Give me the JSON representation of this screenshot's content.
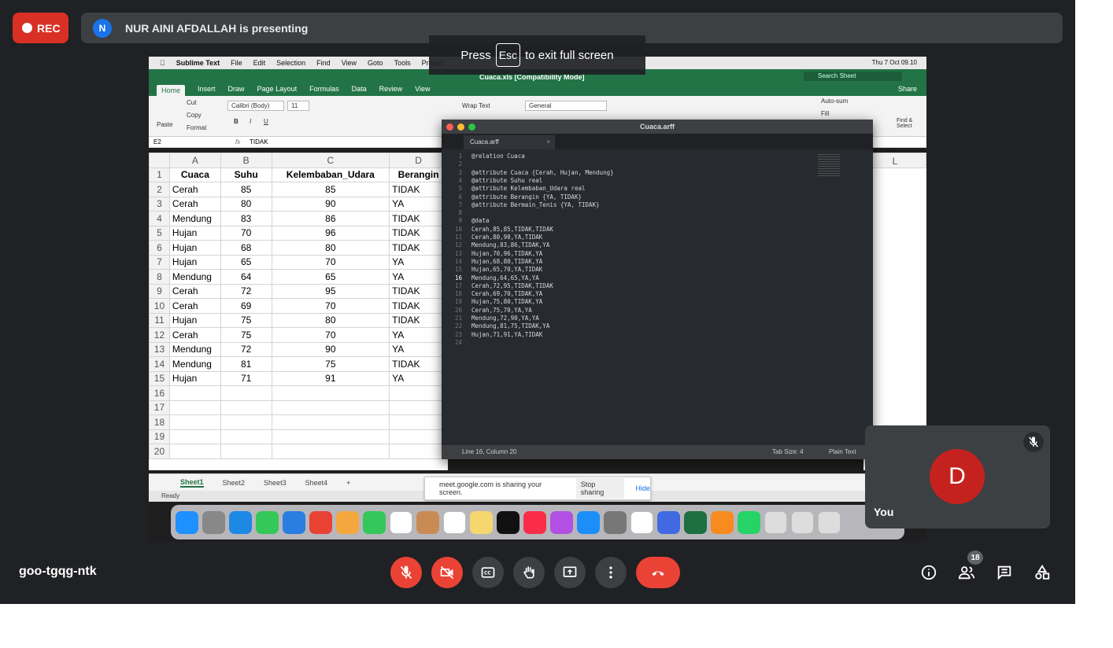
{
  "recording": {
    "label": "REC"
  },
  "presenter": {
    "initial": "N",
    "text": "NUR AINI AFDALLAH is presenting"
  },
  "fullscreen_tip": {
    "press": "Press",
    "key": "Esc",
    "rest": "to exit full screen"
  },
  "mac_menu": {
    "app": "Sublime Text",
    "items": [
      "File",
      "Edit",
      "Selection",
      "Find",
      "View",
      "Goto",
      "Tools",
      "Project"
    ],
    "clock": "Thu 7 Oct  09.10"
  },
  "excel": {
    "title": "Cuaca.xls  [Compatibility Mode]",
    "search_placeholder": "Search Sheet",
    "share": "Share",
    "tabs": [
      "Home",
      "Insert",
      "Draw",
      "Page Layout",
      "Formulas",
      "Data",
      "Review",
      "View"
    ],
    "ribbon": {
      "paste": "Paste",
      "cut": "Cut",
      "copy": "Copy",
      "format": "Format",
      "font": "Calibri (Body)",
      "size": "11",
      "wrap": "Wrap Text",
      "number_format": "General",
      "autosum": "Auto-sum",
      "fill": "Fill",
      "find": "Find &\nSelect"
    },
    "cell_ref": "E2",
    "formula": "TIDAK",
    "columns": [
      "A",
      "B",
      "C",
      "D"
    ],
    "far_column": "L",
    "headers": [
      "Cuaca",
      "Suhu",
      "Kelembaban_Udara",
      "Berangin"
    ],
    "rows": [
      [
        "Cerah",
        "85",
        "85",
        "TIDAK"
      ],
      [
        "Cerah",
        "80",
        "90",
        "YA"
      ],
      [
        "Mendung",
        "83",
        "86",
        "TIDAK"
      ],
      [
        "Hujan",
        "70",
        "96",
        "TIDAK"
      ],
      [
        "Hujan",
        "68",
        "80",
        "TIDAK"
      ],
      [
        "Hujan",
        "65",
        "70",
        "YA"
      ],
      [
        "Mendung",
        "64",
        "65",
        "YA"
      ],
      [
        "Cerah",
        "72",
        "95",
        "TIDAK"
      ],
      [
        "Cerah",
        "69",
        "70",
        "TIDAK"
      ],
      [
        "Hujan",
        "75",
        "80",
        "TIDAK"
      ],
      [
        "Cerah",
        "75",
        "70",
        "YA"
      ],
      [
        "Mendung",
        "72",
        "90",
        "YA"
      ],
      [
        "Mendung",
        "81",
        "75",
        "TIDAK"
      ],
      [
        "Hujan",
        "71",
        "91",
        "YA"
      ]
    ],
    "empty_rows": [
      "16",
      "17",
      "18",
      "19",
      "20"
    ],
    "sheets": [
      "Sheet1",
      "Sheet2",
      "Sheet3",
      "Sheet4"
    ],
    "add_sheet": "+",
    "status": "Ready"
  },
  "share_popup": {
    "text": "meet.google.com is sharing your screen.",
    "stop": "Stop sharing",
    "hide": "Hide"
  },
  "sublime": {
    "title": "Cuaca.arff",
    "tab": "Cuaca.arff",
    "lines": [
      "@relation Cuaca",
      "",
      "@attribute Cuaca {Cerah, Hujan, Mendung}",
      "@attribute Suhu real",
      "@attribute Kelembaban_Udara real",
      "@attribute Berangin {YA, TIDAK}",
      "@attribute Bermain_Tenis {YA, TIDAK}",
      "",
      "@data",
      "Cerah,85,85,TIDAK,TIDAK",
      "Cerah,80,90,YA,TIDAK",
      "Mendung,83,86,TIDAK,YA",
      "Hujan,70,96,TIDAK,YA",
      "Hujan,68,80,TIDAK,YA",
      "Hujan,65,70,YA,TIDAK",
      "Mendung,64,65,YA,YA",
      "Cerah,72,95,TIDAK,TIDAK",
      "Cerah,69,70,TIDAK,YA",
      "Hujan,75,80,TIDAK,YA",
      "Cerah,75,70,YA,YA",
      "Mendung,72,90,YA,YA",
      "Mendung,81,75,TIDAK,YA",
      "Hujan,71,91,YA,TIDAK",
      ""
    ],
    "status_left": "Line 16, Column 20",
    "tab_size": "Tab Size: 4",
    "syntax": "Plain Text"
  },
  "self_view": {
    "initial": "D",
    "name": "You"
  },
  "meeting_code": "goo-tgqg-ntk",
  "participants_count": "18"
}
